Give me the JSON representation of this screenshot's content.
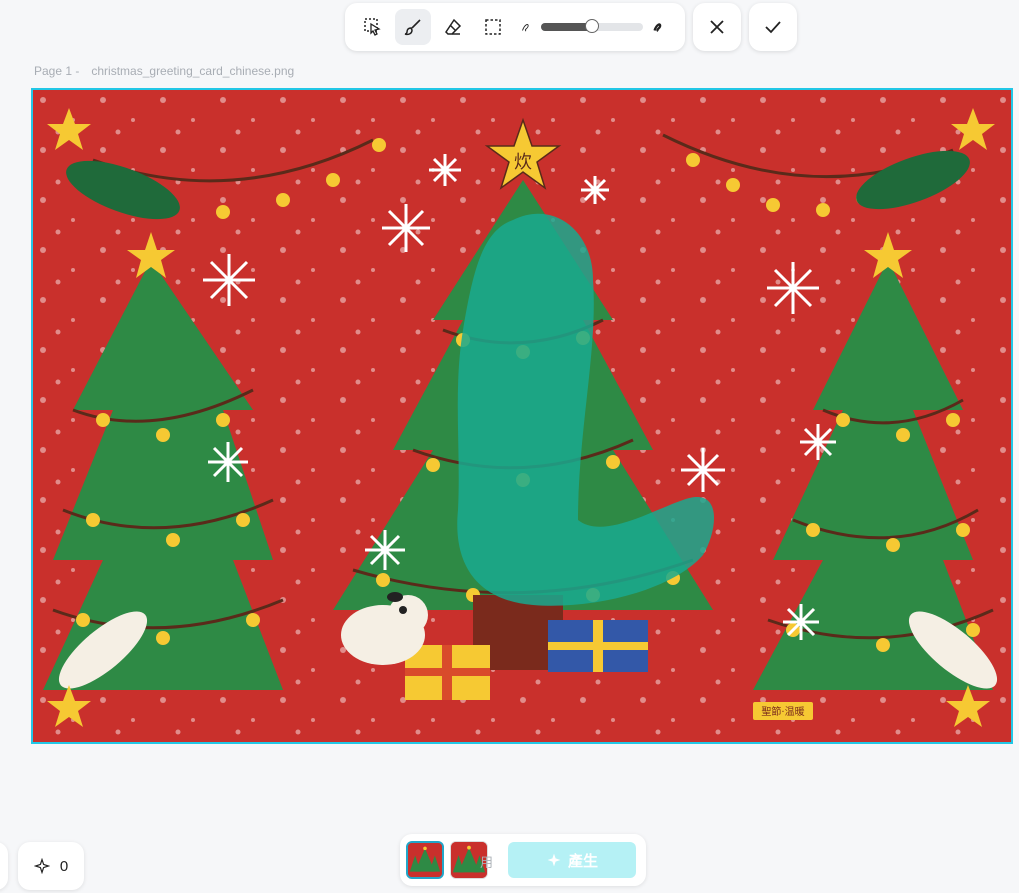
{
  "toolbar": {
    "tools": [
      {
        "name": "lasso-select-icon",
        "active": false
      },
      {
        "name": "brush-icon",
        "active": true
      },
      {
        "name": "eraser-icon",
        "active": false
      },
      {
        "name": "rectangle-select-icon",
        "active": false
      }
    ],
    "brush_size_fraction": 0.5,
    "cancel_icon": "close-icon",
    "confirm_icon": "check-icon"
  },
  "page": {
    "label": "Page 1 -",
    "filename": "christmas_greeting_card_chinese.png"
  },
  "canvas": {
    "background": "#c9302c",
    "selection_border": "#22c7e6",
    "mask_color": "#19a98f",
    "artwork_texts": {
      "star_glyph": "炊",
      "bottom_tag": "聖節·温暖"
    }
  },
  "bottom": {
    "credits_icon": "sparkle-icon",
    "credits": "0",
    "hidden_label": "用",
    "generate_label": "產生",
    "generate_icon": "sparkle-icon",
    "generate_color": "#b5f1f5"
  }
}
